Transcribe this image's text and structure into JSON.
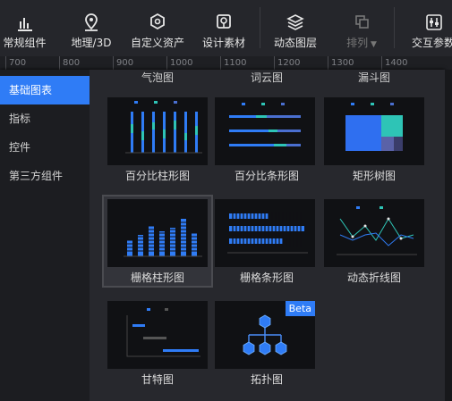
{
  "toolbar": {
    "items": [
      {
        "label": "常规组件",
        "icon": "bar-chart-icon"
      },
      {
        "label": "地理/3D",
        "icon": "map-pin-icon"
      },
      {
        "label": "自定义资产",
        "icon": "hexagon-icon"
      },
      {
        "label": "设计素材",
        "icon": "design-asset-icon"
      },
      {
        "label": "动态图层",
        "icon": "layers-icon"
      },
      {
        "label": "排列",
        "icon": "arrange-icon"
      },
      {
        "label": "交互参数",
        "icon": "interaction-icon"
      }
    ]
  },
  "ruler": {
    "ticks": [
      "700",
      "800",
      "900",
      "1000",
      "1100",
      "1200",
      "1300",
      "1400"
    ]
  },
  "sidebar": {
    "items": [
      {
        "label": "基础图表",
        "active": true
      },
      {
        "label": "指标"
      },
      {
        "label": "控件"
      },
      {
        "label": "第三方组件"
      }
    ]
  },
  "gallery": {
    "top_cut_labels": [
      "气泡图",
      "词云图",
      "漏斗图"
    ],
    "cards": [
      {
        "label": "百分比柱形图",
        "icon": "percent-column-chart-thumb"
      },
      {
        "label": "百分比条形图",
        "icon": "percent-bar-chart-thumb"
      },
      {
        "label": "矩形树图",
        "icon": "treemap-thumb"
      },
      {
        "label": "栅格柱形图",
        "icon": "grid-column-chart-thumb"
      },
      {
        "label": "栅格条形图",
        "icon": "grid-bar-chart-thumb"
      },
      {
        "label": "动态折线图",
        "icon": "dynamic-line-chart-thumb"
      },
      {
        "label": "甘特图",
        "icon": "gantt-chart-thumb"
      },
      {
        "label": "拓扑图",
        "icon": "topology-thumb",
        "badge": "Beta"
      }
    ]
  },
  "colors": {
    "accent": "#2f7cf6",
    "teal": "#2ec4b6",
    "panel": "#27282d"
  }
}
